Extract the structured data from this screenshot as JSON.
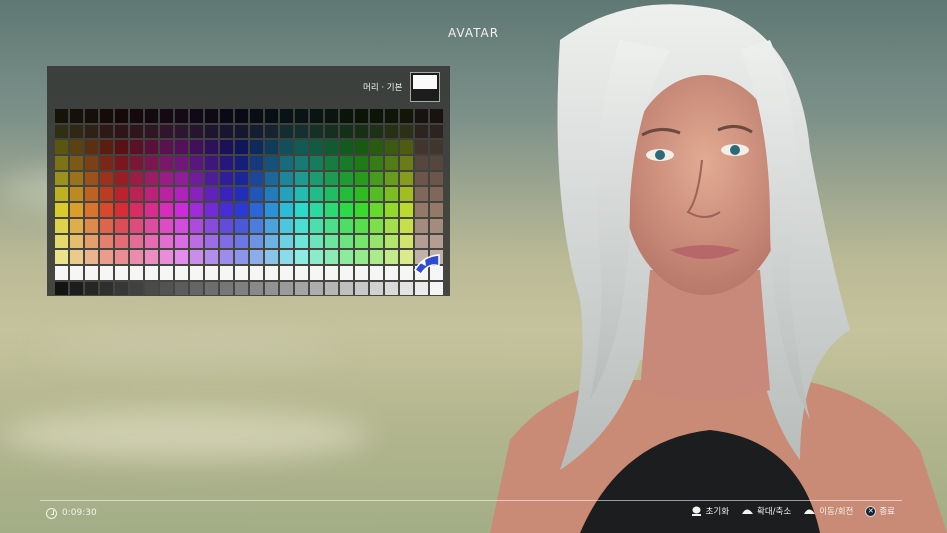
{
  "header": {
    "title": "AVATAR"
  },
  "palette": {
    "preview_label": "머리 · 기본",
    "selected_color": "#fafafa",
    "rows": 12,
    "cols": 26
  },
  "footer": {
    "timer": "0:09:30",
    "controls": [
      {
        "button": "L-stick",
        "label": "초기화"
      },
      {
        "button": "L",
        "label": "확대/축소"
      },
      {
        "button": "R",
        "label": "이동/회전"
      },
      {
        "button": "X",
        "label": "종료"
      }
    ]
  },
  "colors": {
    "panel_bg": "#343632",
    "cursor": "#2d4bd6",
    "text": "#f2f2ee"
  }
}
